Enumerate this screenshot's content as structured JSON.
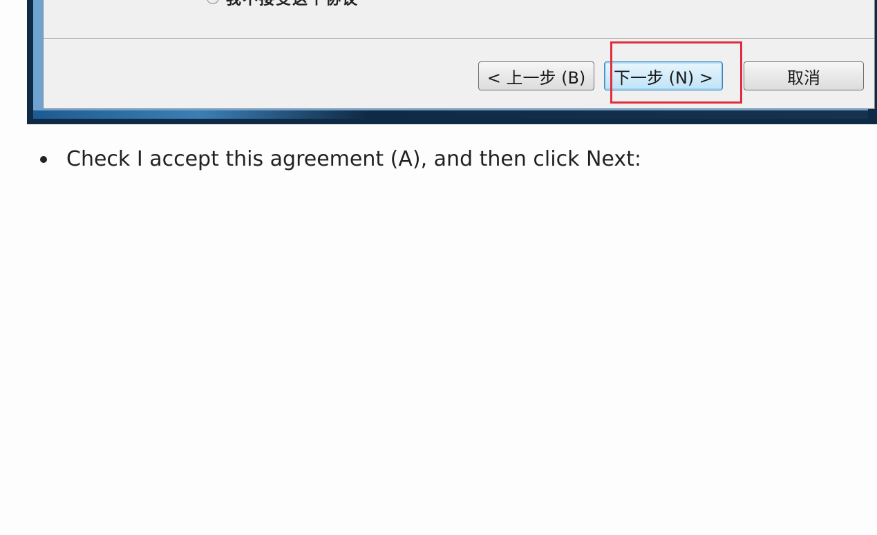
{
  "dialog": {
    "clipped_option_text": "我不接受这个协议",
    "buttons": {
      "back_label": "< 上一步 (B)",
      "next_label": "下一步 (N) >",
      "cancel_label": "取消"
    }
  },
  "instructions": {
    "items": [
      {
        "text": "Check I accept this agreement (A), and then click Next:"
      }
    ]
  },
  "colors": {
    "highlight": "#e02c3c",
    "next_button": "#bfe3f7",
    "dialog_bg": "#f0f0f0"
  }
}
